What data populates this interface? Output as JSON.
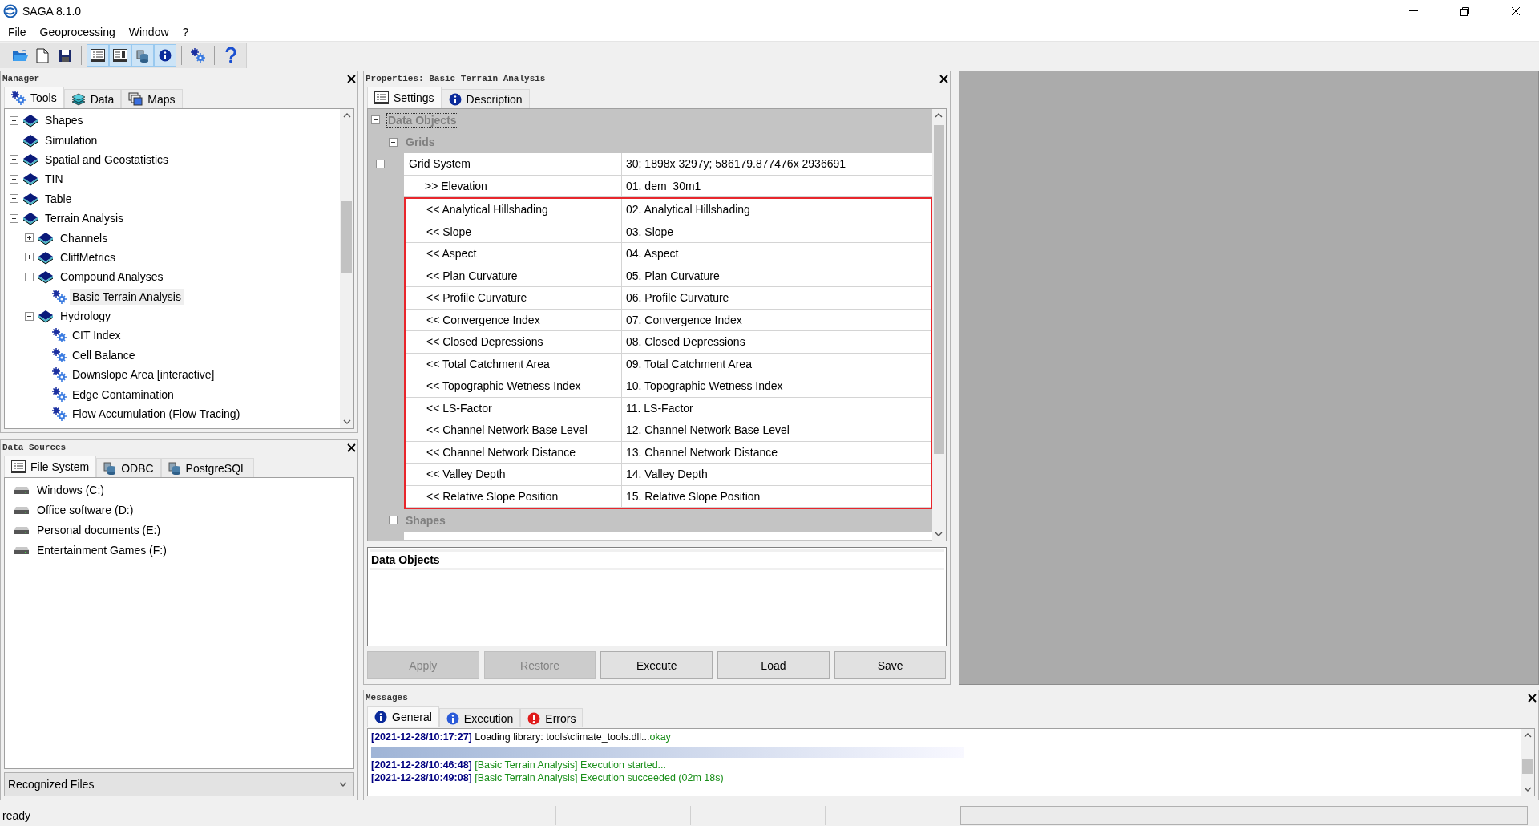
{
  "window": {
    "title": "SAGA 8.1.0"
  },
  "menu": [
    "File",
    "Geoprocessing",
    "Window",
    "?"
  ],
  "toolbar": [
    {
      "buttons": [
        {
          "kind": "open",
          "pressed": false
        },
        {
          "kind": "new",
          "pressed": false
        },
        {
          "kind": "save",
          "pressed": false
        }
      ]
    },
    {
      "buttons": [
        {
          "kind": "manager",
          "pressed": true
        },
        {
          "kind": "properties",
          "pressed": true
        },
        {
          "kind": "data-sources",
          "pressed": true
        },
        {
          "kind": "info",
          "pressed": true
        }
      ]
    },
    {
      "buttons": [
        {
          "kind": "tools",
          "pressed": false
        }
      ]
    },
    {
      "buttons": [
        {
          "kind": "help",
          "pressed": false
        }
      ]
    }
  ],
  "manager": {
    "title": "Manager",
    "tabs": [
      {
        "label": "Tools",
        "kind": "tools",
        "selected": true
      },
      {
        "label": "Data",
        "kind": "data",
        "selected": false
      },
      {
        "label": "Maps",
        "kind": "maps",
        "selected": false
      }
    ],
    "tree": [
      {
        "label": "Shapes",
        "kind": "library",
        "expanded": false,
        "selected": false
      },
      {
        "label": "Simulation",
        "kind": "library",
        "expanded": false,
        "selected": false
      },
      {
        "label": "Spatial and Geostatistics",
        "kind": "library",
        "expanded": false,
        "selected": false
      },
      {
        "label": "TIN",
        "kind": "library",
        "expanded": false,
        "selected": false
      },
      {
        "label": "Table",
        "kind": "library",
        "expanded": false,
        "selected": false
      },
      {
        "label": "Terrain Analysis",
        "kind": "library",
        "expanded": true,
        "selected": false,
        "children": [
          {
            "label": "Channels",
            "kind": "library",
            "expanded": false,
            "selected": false
          },
          {
            "label": "CliffMetrics",
            "kind": "library",
            "expanded": false,
            "selected": false
          },
          {
            "label": "Compound Analyses",
            "kind": "library",
            "expanded": true,
            "selected": false,
            "children": [
              {
                "label": "Basic Terrain Analysis",
                "kind": "tool",
                "selected": true
              }
            ]
          },
          {
            "label": "Hydrology",
            "kind": "library",
            "expanded": true,
            "selected": false,
            "children": [
              {
                "label": "CIT Index",
                "kind": "tool",
                "selected": false
              },
              {
                "label": "Cell Balance",
                "kind": "tool",
                "selected": false
              },
              {
                "label": "Downslope Area [interactive]",
                "kind": "tool",
                "selected": false
              },
              {
                "label": "Edge Contamination",
                "kind": "tool",
                "selected": false
              },
              {
                "label": "Flow Accumulation (Flow Tracing)",
                "kind": "tool",
                "selected": false
              }
            ]
          }
        ]
      }
    ]
  },
  "data_sources": {
    "title": "Data Sources",
    "tabs": [
      {
        "label": "File System",
        "kind": "files",
        "selected": true
      },
      {
        "label": "ODBC",
        "kind": "database",
        "selected": false
      },
      {
        "label": "PostgreSQL",
        "kind": "database",
        "selected": false
      }
    ],
    "drives": [
      "Windows (C:)",
      "Office software (D:)",
      "Personal documents (E:)",
      "Entertainment Games (F:)"
    ],
    "filter": "Recognized Files"
  },
  "properties": {
    "title": "Properties: Basic Terrain Analysis",
    "tabs": [
      {
        "label": "Settings",
        "kind": "settings",
        "selected": true
      },
      {
        "label": "Description",
        "kind": "info",
        "selected": false
      }
    ],
    "tree": [
      {
        "label": "Data Objects",
        "kind": "category",
        "expanded": true,
        "focused": true,
        "children": [
          {
            "label": "Grids",
            "kind": "category",
            "expanded": true,
            "focused": false,
            "children": [
              {
                "label": "Grid System",
                "kind": "parameter",
                "value": "30; 1898x 3297y; 586179.877476x 2936691",
                "expanded": true,
                "highlighted": false,
                "children": [
                  {
                    "label": ">> Elevation",
                    "kind": "parameter",
                    "value": "01. dem_30m1",
                    "highlighted": false
                  },
                  {
                    "label": "<< Analytical Hillshading",
                    "kind": "parameter",
                    "value": "02. Analytical Hillshading",
                    "highlighted": true
                  },
                  {
                    "label": "<< Slope",
                    "kind": "parameter",
                    "value": "03. Slope",
                    "highlighted": true
                  },
                  {
                    "label": "<< Aspect",
                    "kind": "parameter",
                    "value": "04. Aspect",
                    "highlighted": true
                  },
                  {
                    "label": "<< Plan Curvature",
                    "kind": "parameter",
                    "value": "05. Plan Curvature",
                    "highlighted": true
                  },
                  {
                    "label": "<< Profile Curvature",
                    "kind": "parameter",
                    "value": "06. Profile Curvature",
                    "highlighted": true
                  },
                  {
                    "label": "<< Convergence Index",
                    "kind": "parameter",
                    "value": "07. Convergence Index",
                    "highlighted": true
                  },
                  {
                    "label": "<< Closed Depressions",
                    "kind": "parameter",
                    "value": "08. Closed Depressions",
                    "highlighted": true
                  },
                  {
                    "label": "<< Total Catchment Area",
                    "kind": "parameter",
                    "value": "09. Total Catchment Area",
                    "highlighted": true
                  },
                  {
                    "label": "<< Topographic Wetness Index",
                    "kind": "parameter",
                    "value": "10. Topographic Wetness Index",
                    "highlighted": true
                  },
                  {
                    "label": "<< LS-Factor",
                    "kind": "parameter",
                    "value": "11. LS-Factor",
                    "highlighted": true
                  },
                  {
                    "label": "<< Channel Network Base Level",
                    "kind": "parameter",
                    "value": "12. Channel Network Base Level",
                    "highlighted": true
                  },
                  {
                    "label": "<< Channel Network Distance",
                    "kind": "parameter",
                    "value": "13. Channel Network Distance",
                    "highlighted": true
                  },
                  {
                    "label": "<< Valley Depth",
                    "kind": "parameter",
                    "value": "14. Valley Depth",
                    "highlighted": true
                  },
                  {
                    "label": "<< Relative Slope Position",
                    "kind": "parameter",
                    "value": "15. Relative Slope Position",
                    "highlighted": true
                  }
                ]
              }
            ]
          },
          {
            "label": "Shapes",
            "kind": "category",
            "expanded": true,
            "focused": false
          }
        ]
      }
    ],
    "description": {
      "title": "Data Objects"
    },
    "buttons": [
      {
        "label": "Apply",
        "disabled": true
      },
      {
        "label": "Restore",
        "disabled": true
      },
      {
        "label": "Execute",
        "disabled": false
      },
      {
        "label": "Load",
        "disabled": false
      },
      {
        "label": "Save",
        "disabled": false
      }
    ]
  },
  "messages": {
    "title": "Messages",
    "tabs": [
      {
        "label": "General",
        "kind": "info",
        "selected": true
      },
      {
        "label": "Execution",
        "kind": "execution",
        "selected": false
      },
      {
        "label": "Errors",
        "kind": "error",
        "selected": false
      }
    ],
    "log": [
      {
        "time": "[2021-12-28/10:17:27]",
        "text": "Loading library: tools\\climate_tools.dll...",
        "result": "okay",
        "kind": "library"
      },
      {
        "kind": "progress"
      },
      {
        "time": "[2021-12-28/10:46:48]",
        "text": "[Basic Terrain Analysis] Execution started...",
        "kind": "tool"
      },
      {
        "time": "[2021-12-28/10:49:08]",
        "text": "[Basic Terrain Analysis] Execution succeeded (02m 18s)",
        "kind": "tool"
      }
    ]
  },
  "status_bar": {
    "text": "ready"
  }
}
